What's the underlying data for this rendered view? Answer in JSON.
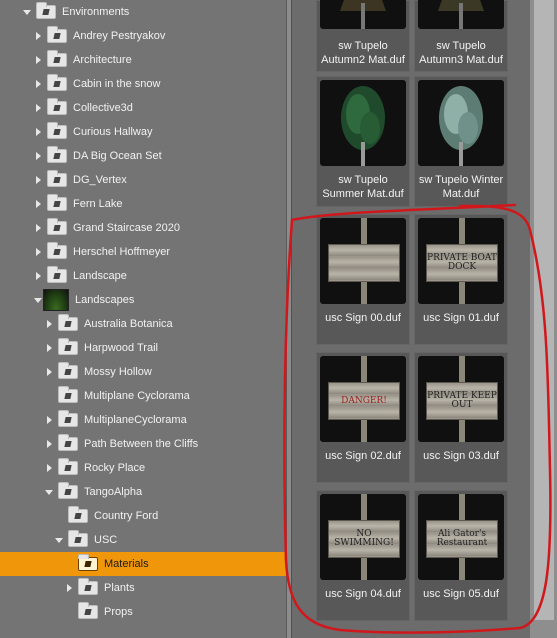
{
  "tree": {
    "environments": "Environments",
    "items": [
      {
        "label": "Andrey Pestryakov"
      },
      {
        "label": "Architecture"
      },
      {
        "label": "Cabin in the snow"
      },
      {
        "label": "Collective3d"
      },
      {
        "label": "Curious Hallway"
      },
      {
        "label": "DA Big Ocean Set"
      },
      {
        "label": "DG_Vertex"
      },
      {
        "label": "Fern Lake"
      },
      {
        "label": "Grand Staircase 2020"
      },
      {
        "label": "Herschel Hoffmeyer"
      },
      {
        "label": "Landscape"
      }
    ],
    "landscapes": "Landscapes",
    "landscapes_children": [
      {
        "label": "Australia Botanica"
      },
      {
        "label": "Harpwood Trail"
      },
      {
        "label": "Mossy Hollow"
      },
      {
        "label": "Multiplane Cyclorama"
      },
      {
        "label": "MultiplaneCyclorama"
      },
      {
        "label": "Path Between the Cliffs"
      },
      {
        "label": "Rocky Place"
      }
    ],
    "tangoalpha": "TangoAlpha",
    "country_ford": "Country Ford",
    "usc": "USC",
    "materials": "Materials",
    "plants": "Plants",
    "props": "Props"
  },
  "grid": {
    "tiles": [
      {
        "caption": "sw Tupelo Autumn2 Mat.duf"
      },
      {
        "caption": "sw Tupelo Autumn3 Mat.duf"
      },
      {
        "caption": "sw Tupelo Summer Mat.duf"
      },
      {
        "caption": "sw Tupelo Winter Mat.duf"
      },
      {
        "caption": "usc Sign 00.duf",
        "sign_text": ""
      },
      {
        "caption": "usc Sign 01.duf",
        "sign_text": "PRIVATE BOAT DOCK"
      },
      {
        "caption": "usc Sign 02.duf",
        "sign_text": "DANGER!"
      },
      {
        "caption": "usc Sign 03.duf",
        "sign_text": "PRIVATE KEEP OUT"
      },
      {
        "caption": "usc Sign 04.duf",
        "sign_text": "NO SWIMMING!"
      },
      {
        "caption": "usc Sign 05.duf",
        "sign_text": "Ali Gator's Restaurant"
      }
    ]
  },
  "colors": {
    "selection": "#f0960a",
    "annotation": "#d0181c"
  }
}
